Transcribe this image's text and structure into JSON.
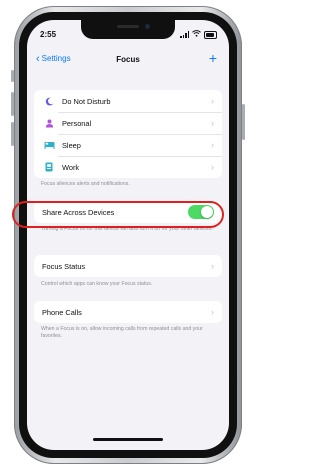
{
  "status_bar": {
    "time": "2:55"
  },
  "nav": {
    "back_label": "Settings",
    "title": "Focus",
    "add_label": "+"
  },
  "focus_modes": [
    {
      "label": "Do Not Disturb",
      "icon": "moon-icon",
      "color": "#5e5ce6"
    },
    {
      "label": "Personal",
      "icon": "person-icon",
      "color": "#af52de"
    },
    {
      "label": "Sleep",
      "icon": "bed-icon",
      "color": "#30b0c7"
    },
    {
      "label": "Work",
      "icon": "badge-icon",
      "color": "#30b0c7"
    }
  ],
  "focus_note": "Focus silences alerts and notifications.",
  "share": {
    "label": "Share Across Devices",
    "enabled": true,
    "note": "Turning a Focus on for this device will also turn it on for your other devices."
  },
  "focus_status": {
    "label": "Focus Status",
    "note": "Control which apps can know your Focus status."
  },
  "phone_calls": {
    "label": "Phone Calls",
    "note": "When a Focus is on, allow incoming calls from repeated calls and your favorites."
  },
  "colors": {
    "accent": "#0a7aff",
    "toggle_on": "#4cd964",
    "highlight": "#e02020"
  }
}
